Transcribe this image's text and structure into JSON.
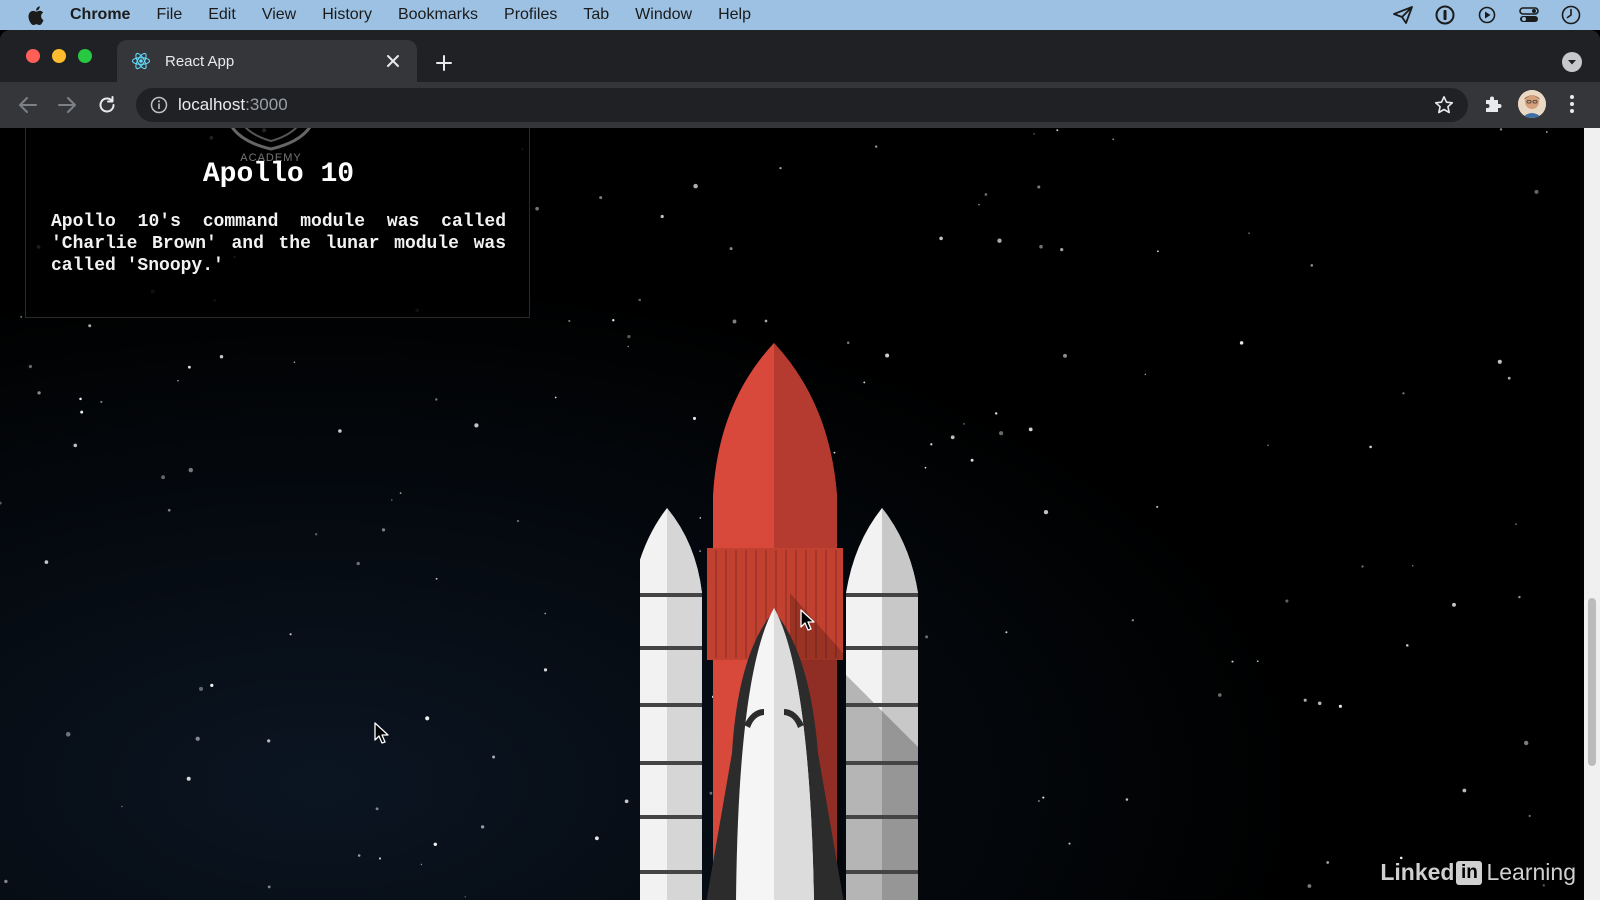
{
  "menubar": {
    "items": [
      "Chrome",
      "File",
      "Edit",
      "View",
      "History",
      "Bookmarks",
      "Profiles",
      "Tab",
      "Window",
      "Help"
    ]
  },
  "tab": {
    "title": "React App"
  },
  "omnibox": {
    "host": "localhost",
    "port": ":3000"
  },
  "card": {
    "seal_text": "ACADEMY",
    "title": "Apollo 10",
    "body": "Apollo 10's command module was called 'Charlie Brown' and the lunar module was called 'Snoopy.'"
  },
  "watermark": {
    "linked": "Linked",
    "in": "in",
    "learning": "Learning"
  },
  "colors": {
    "menubar": "#9cc1e3",
    "chrome_dark": "#202124",
    "tab_active": "#35363a",
    "rocket_red": "#d9493b",
    "space": "#000000"
  }
}
